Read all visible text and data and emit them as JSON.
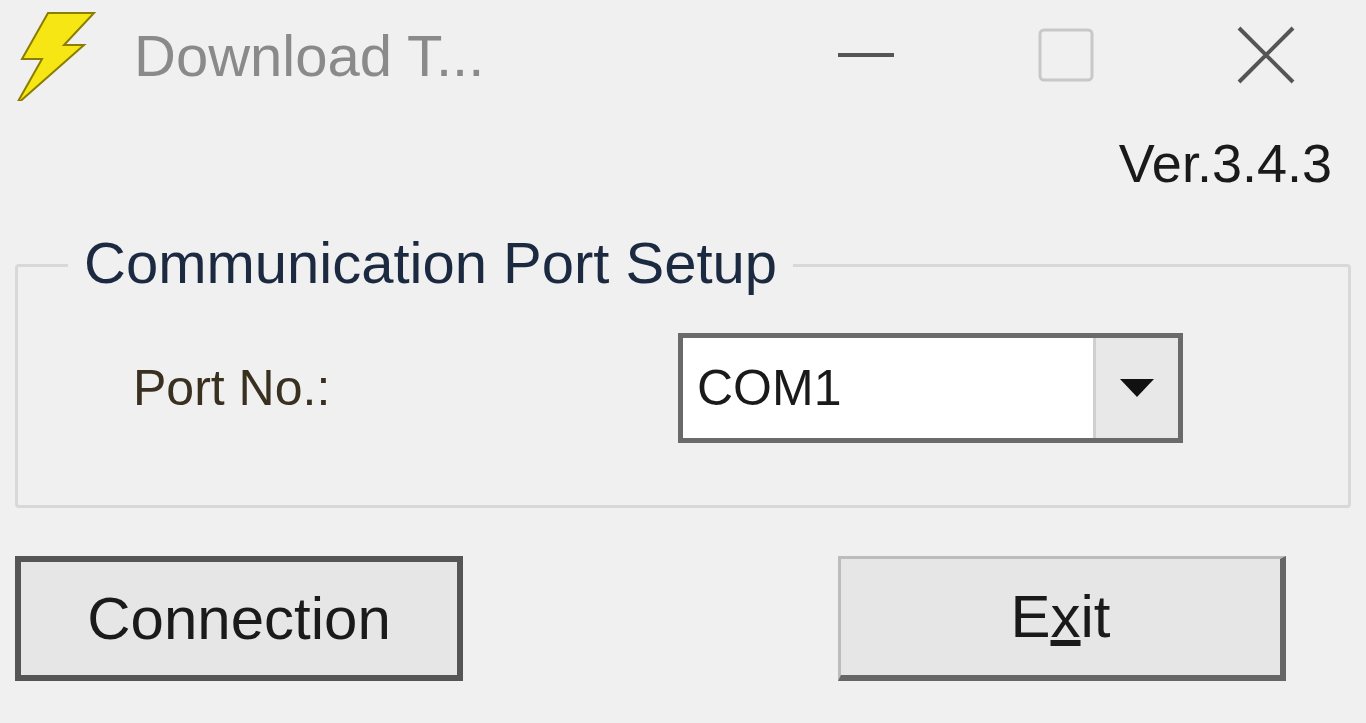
{
  "window": {
    "title": "Download T...",
    "controls": [
      {
        "kind": "minimize",
        "disabled": false
      },
      {
        "kind": "maximize",
        "disabled": true
      },
      {
        "kind": "close",
        "disabled": false
      }
    ]
  },
  "version": "Ver.3.4.3",
  "group": {
    "title": "Communication Port Setup",
    "port_label": "Port No.:",
    "port_value": "COM1"
  },
  "buttons": [
    {
      "label": "Connection",
      "default": true
    },
    {
      "label": "E",
      "access_key": "x",
      "label_after": "it",
      "default": false
    }
  ]
}
